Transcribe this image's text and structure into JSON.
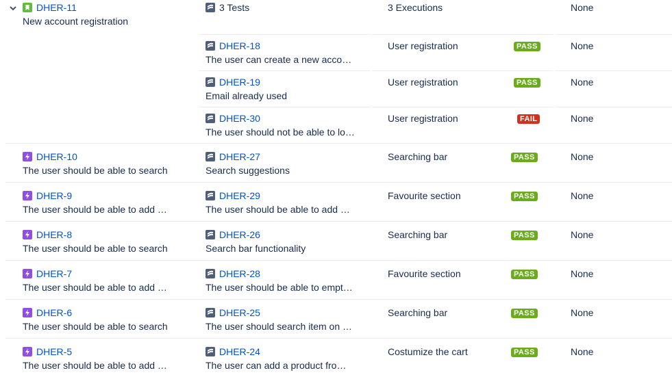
{
  "group": {
    "parent": {
      "key": "DHER-11",
      "summary": "New account registration"
    },
    "summary_row": {
      "tests": "3 Tests",
      "executions": "3 Executions",
      "defects": "None"
    },
    "children": [
      {
        "key": "DHER-18",
        "summary": "The user can create a new acco…",
        "component": "User registration",
        "status": "PASS",
        "defects": "None"
      },
      {
        "key": "DHER-19",
        "summary": "Email already used",
        "component": "User registration",
        "status": "PASS",
        "defects": "None"
      },
      {
        "key": "DHER-30",
        "summary": "The user should not be able to lo…",
        "component": "User registration",
        "status": "FAIL",
        "defects": "None"
      }
    ]
  },
  "rows": [
    {
      "req_key": "DHER-10",
      "req_summary": "The user should be able to search",
      "test_key": "DHER-27",
      "test_summary": "Search suggestions",
      "component": "Searching bar",
      "status": "PASS",
      "defects": "None"
    },
    {
      "req_key": "DHER-9",
      "req_summary": "The user should be able to add …",
      "test_key": "DHER-29",
      "test_summary": "The user should be able to add …",
      "component": "Favourite section",
      "status": "PASS",
      "defects": "None"
    },
    {
      "req_key": "DHER-8",
      "req_summary": "The user should be able to search",
      "test_key": "DHER-26",
      "test_summary": "Search bar functionality",
      "component": "Searching bar",
      "status": "PASS",
      "defects": "None"
    },
    {
      "req_key": "DHER-7",
      "req_summary": "The user should be able to add …",
      "test_key": "DHER-28",
      "test_summary": "The user should be able to empt…",
      "component": "Favourite section",
      "status": "PASS",
      "defects": "None"
    },
    {
      "req_key": "DHER-6",
      "req_summary": "The user should be able to search",
      "test_key": "DHER-25",
      "test_summary": "The user should search item on …",
      "component": "Searching bar",
      "status": "PASS",
      "defects": "None"
    },
    {
      "req_key": "DHER-5",
      "req_summary": "The user should be able to add …",
      "test_key": "DHER-24",
      "test_summary": "The user can add a product fro…",
      "component": "Costumize the cart",
      "status": "PASS",
      "defects": "None"
    }
  ],
  "icons": {
    "story": "story-icon",
    "epic": "epic-icon",
    "test": "test-icon",
    "expand": "chevron-down-icon"
  },
  "colors": {
    "link": "#0052cc",
    "pass": "#6aac1b",
    "fail": "#d0321e",
    "story": "#63ba3c",
    "epic": "#904ee2",
    "test": "#505f79"
  }
}
